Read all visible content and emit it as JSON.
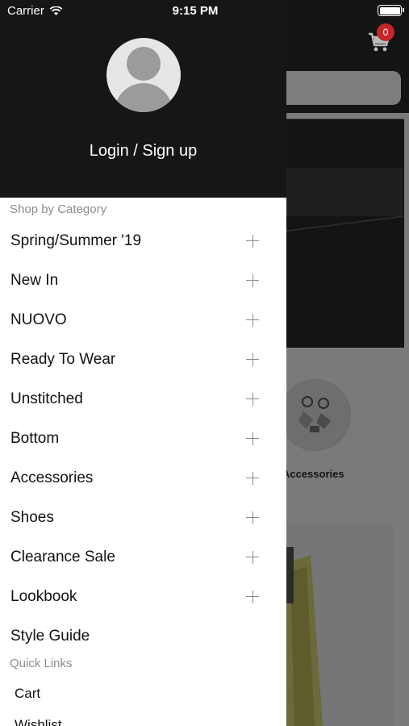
{
  "status_bar": {
    "carrier": "Carrier",
    "time": "9:15 PM"
  },
  "background": {
    "cart_count": "0",
    "category_label": "Accessories"
  },
  "drawer": {
    "login_label": "Login / Sign up",
    "shop_by_category_label": "Shop by Category",
    "categories": [
      {
        "label": "Spring/Summer '19",
        "expandable": true
      },
      {
        "label": "New In",
        "expandable": true
      },
      {
        "label": "NUOVO",
        "expandable": true
      },
      {
        "label": "Ready To Wear",
        "expandable": true
      },
      {
        "label": "Unstitched",
        "expandable": true
      },
      {
        "label": "Bottom",
        "expandable": true
      },
      {
        "label": "Accessories",
        "expandable": true
      },
      {
        "label": "Shoes",
        "expandable": true
      },
      {
        "label": "Clearance Sale",
        "expandable": true
      },
      {
        "label": "Lookbook",
        "expandable": true
      },
      {
        "label": "Style Guide",
        "expandable": false
      }
    ],
    "quick_links_label": "Quick Links",
    "quick_links": [
      {
        "label": "Cart"
      },
      {
        "label": "Wishlist"
      }
    ]
  },
  "icons": {
    "wifi": "wifi-icon",
    "battery": "battery-icon",
    "cart": "cart-icon",
    "avatar": "user-avatar-icon",
    "expand": "plus-icon"
  },
  "colors": {
    "drawer_header": "#161616",
    "badge": "#c4262a",
    "muted_text": "#8c8c8c"
  }
}
